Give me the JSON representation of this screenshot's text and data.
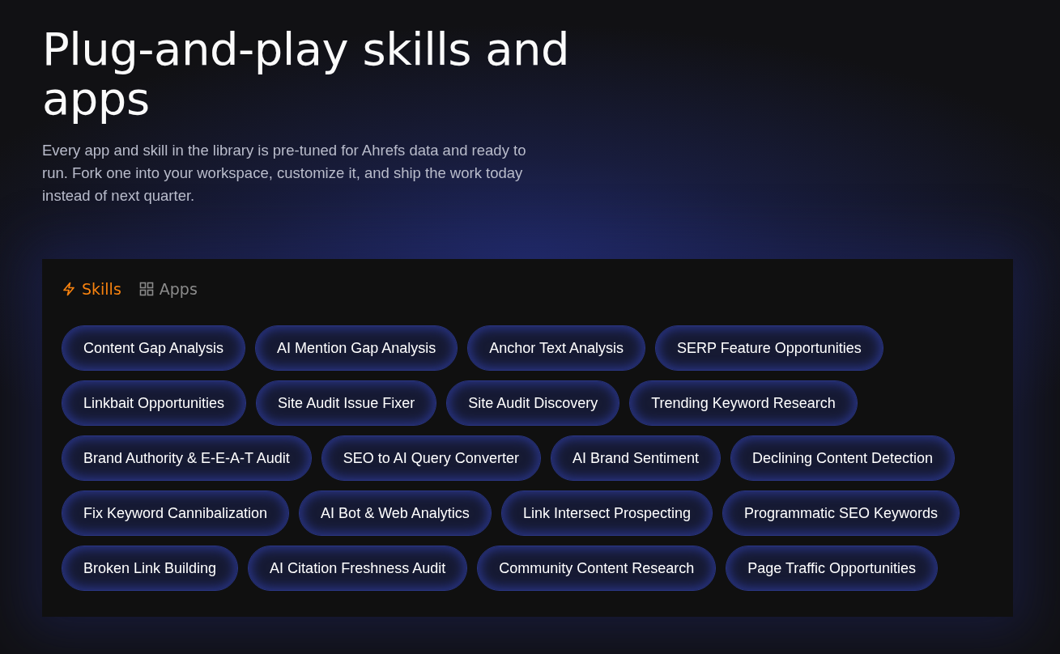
{
  "hero": {
    "title": "Plug-and-play skills and apps",
    "description": "Every app and skill in the library is pre-tuned for Ahrefs data and ready to run. Fork one into your workspace, customize it, and ship the work today instead of next quarter."
  },
  "tabs": [
    {
      "label": "Skills",
      "kind": "bolt",
      "selected": true
    },
    {
      "label": "Apps",
      "kind": "grid",
      "selected": false
    }
  ],
  "skills": [
    "Content Gap Analysis",
    "AI Mention Gap Analysis",
    "Anchor Text Analysis",
    "SERP Feature Opportunities",
    "Linkbait Opportunities",
    "Site Audit Issue Fixer",
    "Site Audit Discovery",
    "Trending Keyword Research",
    "Brand Authority & E-E-A-T Audit",
    "SEO to AI Query Converter",
    "AI Brand Sentiment",
    "Declining Content Detection",
    "Fix Keyword Cannibalization",
    "AI Bot & Web Analytics",
    "Link Intersect Prospecting",
    "Programmatic SEO Keywords",
    "Broken Link Building",
    "AI Citation Freshness Audit",
    "Community Content Research",
    "Page Traffic Opportunities"
  ]
}
